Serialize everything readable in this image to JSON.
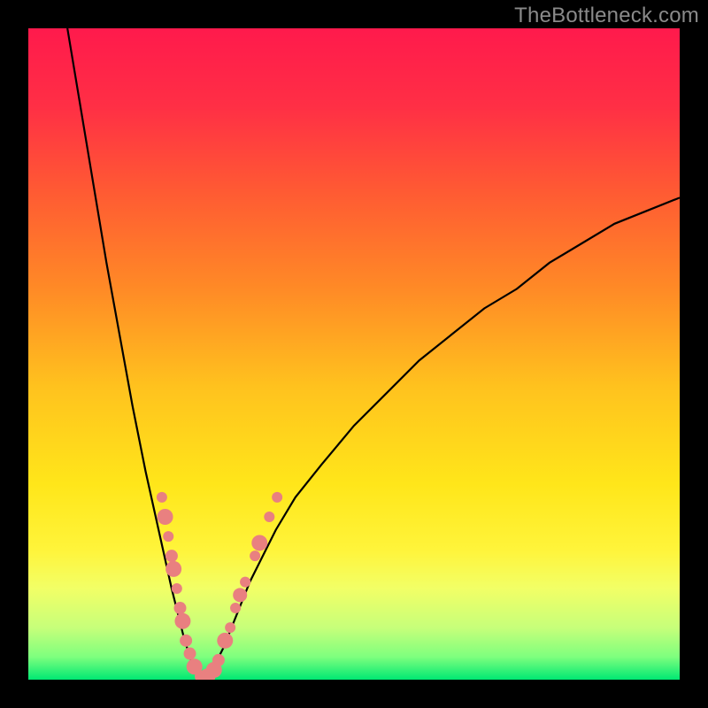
{
  "watermark": "TheBottleneck.com",
  "colors": {
    "gradient_stops": [
      {
        "offset": 0.0,
        "color": "#ff1a4c"
      },
      {
        "offset": 0.12,
        "color": "#ff2f45"
      },
      {
        "offset": 0.25,
        "color": "#ff5a33"
      },
      {
        "offset": 0.4,
        "color": "#ff8a26"
      },
      {
        "offset": 0.55,
        "color": "#ffc21e"
      },
      {
        "offset": 0.7,
        "color": "#ffe61a"
      },
      {
        "offset": 0.8,
        "color": "#fff43a"
      },
      {
        "offset": 0.86,
        "color": "#f2ff66"
      },
      {
        "offset": 0.92,
        "color": "#c7ff7a"
      },
      {
        "offset": 0.965,
        "color": "#7eff7e"
      },
      {
        "offset": 1.0,
        "color": "#00e873"
      }
    ],
    "marker_fill": "#e98080",
    "marker_stroke": "#d96a6a",
    "curve_stroke": "#000000",
    "frame": "#000000",
    "watermark": "#8a8a8a"
  },
  "chart_data": {
    "type": "line",
    "title": "",
    "xlabel": "",
    "ylabel": "",
    "xlim": [
      0,
      100
    ],
    "ylim": [
      0,
      100
    ],
    "grid": false,
    "legend": false,
    "notes": "Bottleneck-style V curve. Y≈100 means worst (red top), Y≈0 means best (green bottom). Curve bottoms out near x≈27. Left branch is steep; right branch rises more gently toward ~74 at x=100. Pink markers cluster on both branches in the lower ~30% of the plot.",
    "series": [
      {
        "name": "bottleneck-curve-left",
        "x": [
          6,
          8,
          10,
          12,
          14,
          16,
          18,
          20,
          22,
          23,
          24,
          25,
          26,
          27
        ],
        "y": [
          100,
          88,
          76,
          64,
          53,
          42,
          32,
          23,
          14,
          10,
          6,
          3,
          1,
          0
        ]
      },
      {
        "name": "bottleneck-curve-right",
        "x": [
          27,
          28,
          29,
          30,
          32,
          34,
          36,
          38,
          41,
          45,
          50,
          55,
          60,
          65,
          70,
          75,
          80,
          85,
          90,
          95,
          100
        ],
        "y": [
          0,
          1,
          3,
          5,
          10,
          15,
          19,
          23,
          28,
          33,
          39,
          44,
          49,
          53,
          57,
          60,
          64,
          67,
          70,
          72,
          74
        ]
      }
    ],
    "markers": [
      {
        "x": 20.5,
        "y": 28,
        "r": 6
      },
      {
        "x": 21.0,
        "y": 25,
        "r": 9
      },
      {
        "x": 21.5,
        "y": 22,
        "r": 6
      },
      {
        "x": 22.0,
        "y": 19,
        "r": 7
      },
      {
        "x": 22.3,
        "y": 17,
        "r": 9
      },
      {
        "x": 22.8,
        "y": 14,
        "r": 6
      },
      {
        "x": 23.3,
        "y": 11,
        "r": 7
      },
      {
        "x": 23.7,
        "y": 9,
        "r": 9
      },
      {
        "x": 24.2,
        "y": 6,
        "r": 7
      },
      {
        "x": 24.8,
        "y": 4,
        "r": 7
      },
      {
        "x": 25.5,
        "y": 2,
        "r": 9
      },
      {
        "x": 26.5,
        "y": 0.5,
        "r": 7
      },
      {
        "x": 27.5,
        "y": 0.5,
        "r": 9
      },
      {
        "x": 28.5,
        "y": 1.5,
        "r": 9
      },
      {
        "x": 29.2,
        "y": 3,
        "r": 7
      },
      {
        "x": 30.2,
        "y": 6,
        "r": 9
      },
      {
        "x": 31.0,
        "y": 8,
        "r": 6
      },
      {
        "x": 31.8,
        "y": 11,
        "r": 6
      },
      {
        "x": 32.5,
        "y": 13,
        "r": 8
      },
      {
        "x": 33.3,
        "y": 15,
        "r": 6
      },
      {
        "x": 34.8,
        "y": 19,
        "r": 6
      },
      {
        "x": 35.5,
        "y": 21,
        "r": 9
      },
      {
        "x": 37.0,
        "y": 25,
        "r": 6
      },
      {
        "x": 38.2,
        "y": 28,
        "r": 6
      }
    ]
  }
}
